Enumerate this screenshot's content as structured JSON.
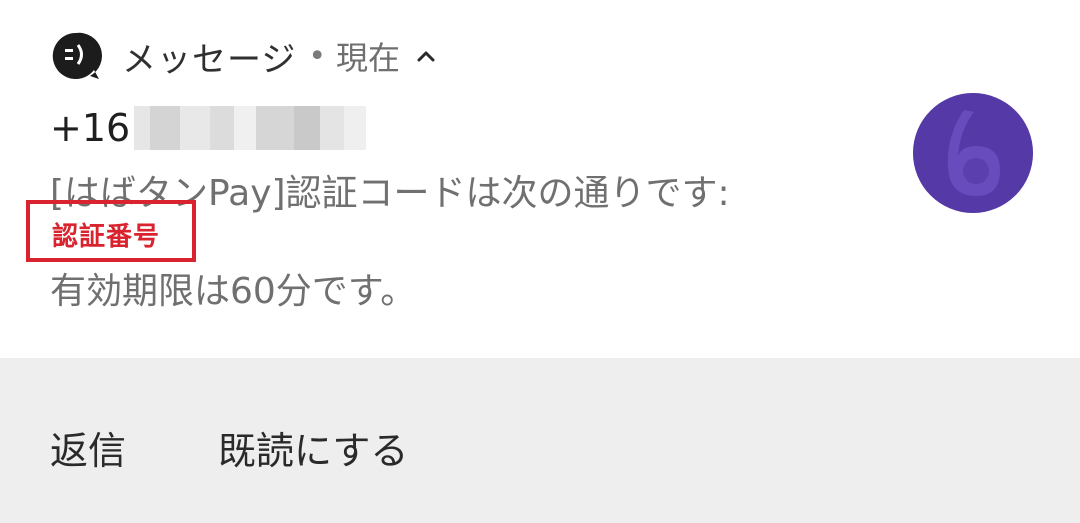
{
  "notification": {
    "app_icon": "messages-app-icon",
    "app_name": "メッセージ",
    "separator": "•",
    "time": "現在",
    "expand_icon": "chevron-up-icon",
    "sender": "+16",
    "message_line1": "[はばタンPay]認証コードは次の通りです:",
    "verification_code_label": "認証番号",
    "message_line3": "有効期限は60分です。",
    "avatar_icon": "contact-avatar-icon",
    "avatar_color": "#5b3fae"
  },
  "actions": {
    "reply_label": "返信",
    "mark_read_label": "既読にする"
  },
  "colors": {
    "highlight_red": "#d9232e",
    "action_bar_bg": "#eeeeee"
  }
}
